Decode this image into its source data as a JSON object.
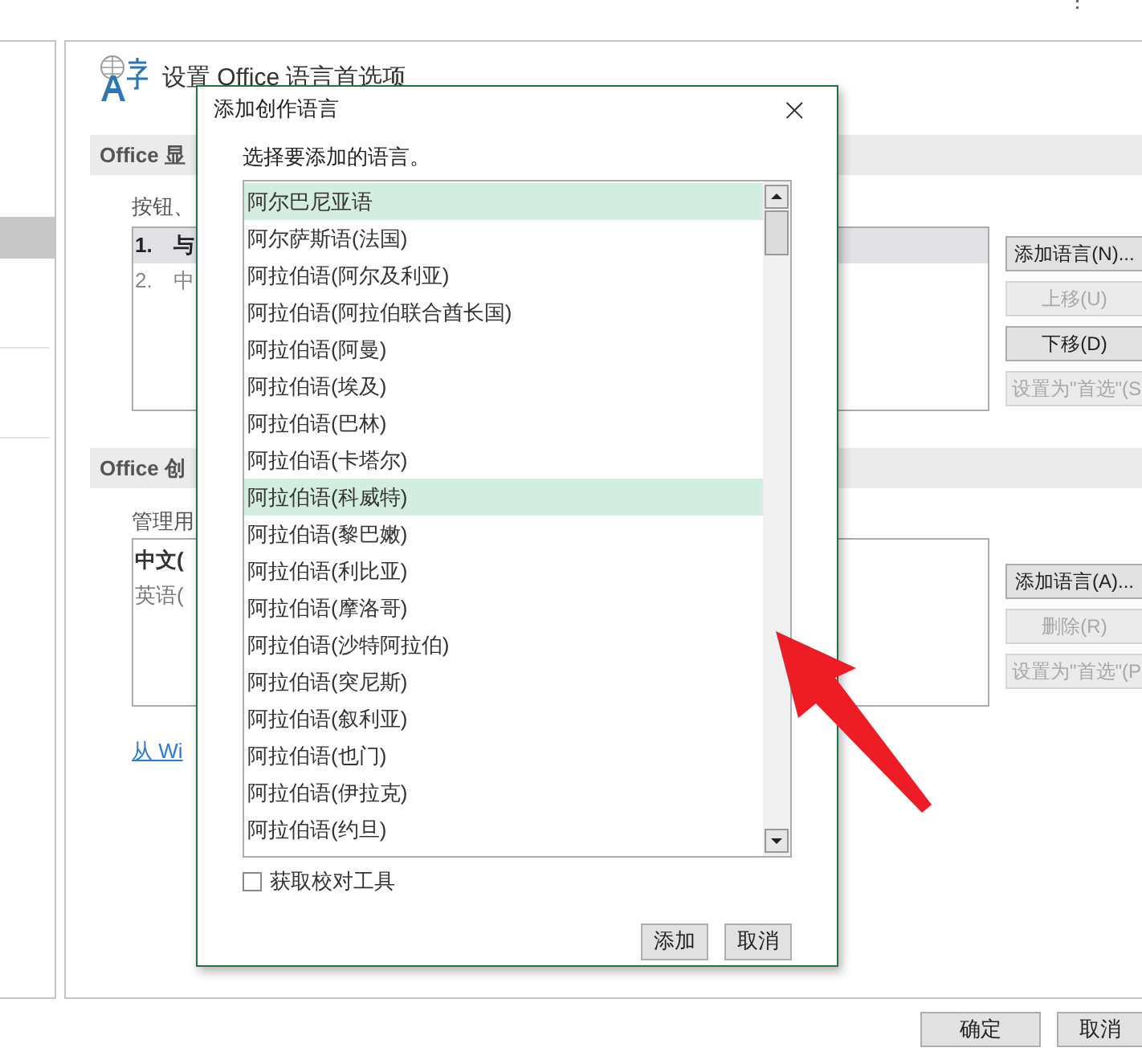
{
  "sidebar": {
    "items": [
      {
        "selected": true
      }
    ]
  },
  "main": {
    "title": "设置 Office 语言首选项",
    "display_section": {
      "header": "Office 显",
      "description": "按钮、",
      "languages": [
        {
          "number": "1.",
          "name": "与",
          "selected": true
        },
        {
          "number": "2.",
          "name": "中",
          "selected": false
        }
      ],
      "buttons": [
        {
          "label": "添加语言(N)...",
          "disabled": false
        },
        {
          "label": "上移(U)",
          "disabled": true
        },
        {
          "label": "下移(D)",
          "disabled": false
        },
        {
          "label": "设置为\"首选\"(S",
          "disabled": true
        }
      ]
    },
    "authoring_section": {
      "header": "Office 创",
      "description": "管理用",
      "languages": [
        {
          "name": "中文(",
          "preferred": true
        },
        {
          "name": "英语(",
          "preferred": false
        }
      ],
      "buttons": [
        {
          "label": "添加语言(A)...",
          "disabled": false
        },
        {
          "label": "删除(R)",
          "disabled": true
        },
        {
          "label": "设置为\"首选\"(P",
          "disabled": true
        }
      ],
      "link": "从 Wi"
    }
  },
  "footer_buttons": [
    "确定",
    "取消"
  ],
  "dialog": {
    "title": "添加创作语言",
    "close": "×",
    "prompt": "选择要添加的语言。",
    "languages": [
      {
        "name": "阿尔巴尼亚语",
        "selected": true
      },
      {
        "name": "阿尔萨斯语(法国)",
        "selected": false
      },
      {
        "name": "阿拉伯语(阿尔及利亚)",
        "selected": false
      },
      {
        "name": "阿拉伯语(阿拉伯联合酋长国)",
        "selected": false
      },
      {
        "name": "阿拉伯语(阿曼)",
        "selected": false
      },
      {
        "name": "阿拉伯语(埃及)",
        "selected": false
      },
      {
        "name": "阿拉伯语(巴林)",
        "selected": false
      },
      {
        "name": "阿拉伯语(卡塔尔)",
        "selected": false
      },
      {
        "name": "阿拉伯语(科威特)",
        "selected": true
      },
      {
        "name": "阿拉伯语(黎巴嫩)",
        "selected": false
      },
      {
        "name": "阿拉伯语(利比亚)",
        "selected": false
      },
      {
        "name": "阿拉伯语(摩洛哥)",
        "selected": false
      },
      {
        "name": "阿拉伯语(沙特阿拉伯)",
        "selected": false
      },
      {
        "name": "阿拉伯语(突尼斯)",
        "selected": false
      },
      {
        "name": "阿拉伯语(叙利亚)",
        "selected": false
      },
      {
        "name": "阿拉伯语(也门)",
        "selected": false
      },
      {
        "name": "阿拉伯语(伊拉克)",
        "selected": false
      },
      {
        "name": "阿拉伯语(约旦)",
        "selected": false
      }
    ],
    "checkbox": {
      "label": "获取校对工具",
      "checked": false
    },
    "buttons": [
      "添加",
      "取消"
    ]
  }
}
